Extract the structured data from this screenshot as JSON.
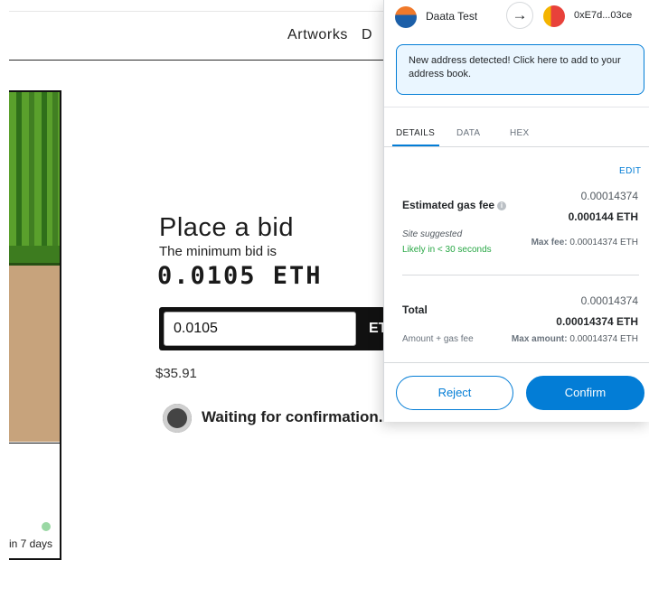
{
  "site": {
    "nav": {
      "artworks": "Artworks",
      "second_partial": "D"
    },
    "card": {
      "sale_ends": "in 7 days"
    },
    "bid": {
      "heading": "Place a bid",
      "min_label": "The minimum bid is",
      "min_value": "0.0105 ETH",
      "input_value": "0.0105",
      "unit_label": "ET",
      "usd_value": "$35.91",
      "status": "Waiting for confirmation..."
    }
  },
  "wallet": {
    "from_account": "Daata Test",
    "arrow_icon": "arrow-right-icon",
    "to_address": "0xE7d...03ce",
    "alert": "New address detected! Click here to add to your address book.",
    "tabs": [
      {
        "label": "DETAILS",
        "active": true
      },
      {
        "label": "DATA",
        "active": false
      },
      {
        "label": "HEX",
        "active": false
      }
    ],
    "edit_label": "EDIT",
    "gas": {
      "label": "Estimated gas fee",
      "primary": "0.00014374",
      "secondary": "0.000144 ETH",
      "site_suggested": "Site suggested",
      "likely": "Likely in < 30 seconds",
      "max_fee_label": "Max fee:",
      "max_fee_value": "0.00014374 ETH"
    },
    "total": {
      "label": "Total",
      "primary": "0.00014374",
      "secondary": "0.00014374 ETH",
      "sublabel": "Amount + gas fee",
      "max_amount_label": "Max amount:",
      "max_amount_value": "0.00014374 ETH"
    },
    "buttons": {
      "reject": "Reject",
      "confirm": "Confirm"
    },
    "colors": {
      "primary_blue": "#037dd6",
      "success_green": "#28a745"
    }
  }
}
